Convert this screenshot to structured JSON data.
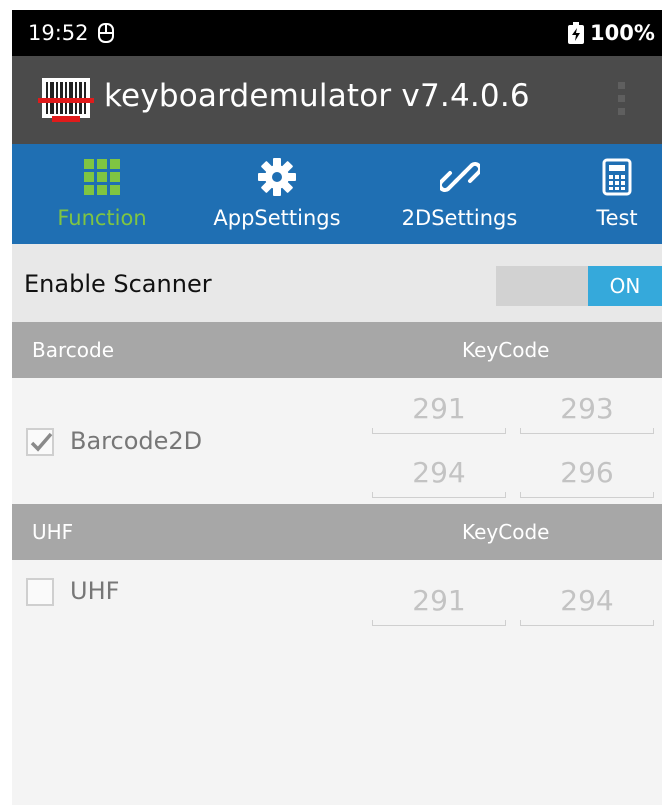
{
  "status_bar": {
    "time": "19:52",
    "battery": "100%"
  },
  "app_bar": {
    "title": "keyboardemulator v7.4.0.6"
  },
  "tabs": [
    {
      "label": "Function",
      "icon": "grid-icon",
      "active": true
    },
    {
      "label": "AppSettings",
      "icon": "gear-icon",
      "active": false
    },
    {
      "label": "2DSettings",
      "icon": "link-icon",
      "active": false
    },
    {
      "label": "Test",
      "icon": "calculator-icon",
      "active": false
    }
  ],
  "enable_scanner": {
    "label": "Enable Scanner",
    "switch_text": "ON",
    "enabled": true
  },
  "barcode_section": {
    "header_left": "Barcode",
    "header_right": "KeyCode",
    "item_label": "Barcode2D",
    "checked": true,
    "keycodes": [
      "291",
      "293",
      "294",
      "296"
    ]
  },
  "uhf_section": {
    "header_left": "UHF",
    "header_right": "KeyCode",
    "item_label": "UHF",
    "checked": false,
    "keycodes": [
      "291",
      "294"
    ]
  },
  "colors": {
    "tab_bar": "#1f6fb3",
    "active_tab": "#7fc542",
    "switch_on": "#35a9db",
    "app_bar": "#4b4b4b"
  }
}
